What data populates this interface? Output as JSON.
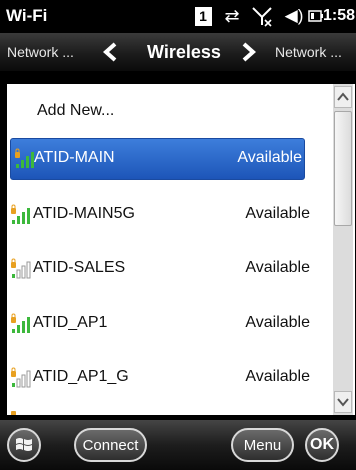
{
  "status_bar": {
    "title": "Wi-Fi",
    "notification_count": "1",
    "time": "1:58"
  },
  "navbar": {
    "prev_label": "Network ...",
    "current_label": "Wireless",
    "next_label": "Network ..."
  },
  "list": {
    "add_new_label": "Add New...",
    "networks": [
      {
        "name": "ATID-MAIN",
        "status": "Available",
        "signal": "strong"
      },
      {
        "name": "ATID-MAIN5G",
        "status": "Available",
        "signal": "strong"
      },
      {
        "name": "ATID-SALES",
        "status": "Available",
        "signal": "weak"
      },
      {
        "name": "ATID_AP1",
        "status": "Available",
        "signal": "strong"
      },
      {
        "name": "ATID_AP1_G",
        "status": "Available",
        "signal": "weak"
      }
    ]
  },
  "bottom_bar": {
    "connect_label": "Connect",
    "menu_label": "Menu",
    "ok_label": "OK"
  },
  "colors": {
    "selection": "#2a64c6",
    "signal_green": "#3cb83c",
    "lock_orange": "#e8a020"
  }
}
